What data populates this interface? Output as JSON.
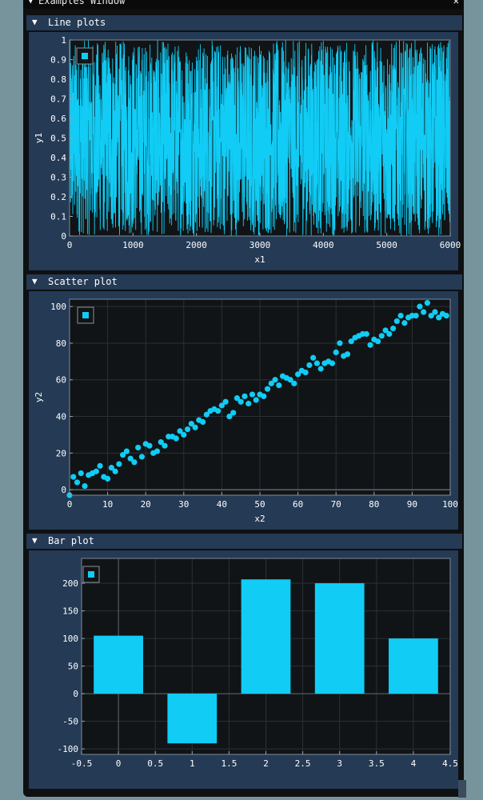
{
  "window": {
    "title": "Examples Window",
    "collapse_glyph": "▼",
    "close_glyph": "✕"
  },
  "sections": [
    {
      "label": "Line plots",
      "glyph": "▼"
    },
    {
      "label": "Scatter plot",
      "glyph": "▼"
    },
    {
      "label": "Bar plot",
      "glyph": "▼"
    }
  ],
  "colors": {
    "series": "#11ccf5",
    "plot_bg": "#111416",
    "frame": "#243a55",
    "header": "#243a55",
    "grid": "#2b3038"
  },
  "chart_data": [
    {
      "type": "line",
      "title": "",
      "xlabel": "x1",
      "ylabel": "y1",
      "xlim": [
        0,
        6000
      ],
      "ylim": [
        0,
        1
      ],
      "xticks": [
        "0",
        "1000",
        "2000",
        "3000",
        "4000",
        "5000",
        "6000"
      ],
      "yticks": [
        "0",
        "0.1",
        "0.2",
        "0.3",
        "0.4",
        "0.5",
        "0.6",
        "0.7",
        "0.8",
        "0.9",
        "1"
      ],
      "series": [
        {
          "points": 6000,
          "min": 0,
          "max": 1,
          "description_values": "dense random noise between 0 and 1"
        }
      ],
      "legend": "top-left"
    },
    {
      "type": "scatter",
      "title": "",
      "xlabel": "x2",
      "ylabel": "y2",
      "xlim": [
        0,
        100
      ],
      "ylim": [
        -3,
        104
      ],
      "xticks": [
        "0",
        "10",
        "20",
        "30",
        "40",
        "50",
        "60",
        "70",
        "80",
        "90",
        "100"
      ],
      "yticks": [
        "0",
        "20",
        "40",
        "60",
        "80",
        "100"
      ],
      "x": [
        0,
        1,
        2,
        3,
        4,
        5,
        6,
        7,
        8,
        9,
        10,
        11,
        12,
        13,
        14,
        15,
        16,
        17,
        18,
        19,
        20,
        21,
        22,
        23,
        24,
        25,
        26,
        27,
        28,
        29,
        30,
        31,
        32,
        33,
        34,
        35,
        36,
        37,
        38,
        39,
        40,
        41,
        42,
        43,
        44,
        45,
        46,
        47,
        48,
        49,
        50,
        51,
        52,
        53,
        54,
        55,
        56,
        57,
        58,
        59,
        60,
        61,
        62,
        63,
        64,
        65,
        66,
        67,
        68,
        69,
        70,
        71,
        72,
        73,
        74,
        75,
        76,
        77,
        78,
        79,
        80,
        81,
        82,
        83,
        84,
        85,
        86,
        87,
        88,
        89,
        90,
        91,
        92,
        93,
        94,
        95,
        96,
        97,
        98,
        99
      ],
      "y": [
        -3,
        7,
        4,
        9,
        2,
        8,
        9,
        10,
        13,
        7,
        6,
        12,
        10,
        14,
        19,
        21,
        17,
        15,
        23,
        18,
        25,
        24,
        20,
        21,
        26,
        24,
        29,
        29,
        28,
        32,
        30,
        33,
        36,
        34,
        38,
        37,
        41,
        43,
        44,
        43,
        46,
        48,
        40,
        42,
        50,
        48,
        51,
        47,
        52,
        49,
        52,
        51,
        55,
        58,
        60,
        57,
        62,
        61,
        60,
        58,
        63,
        65,
        64,
        68,
        72,
        69,
        66,
        69,
        70,
        69,
        75,
        80,
        73,
        74,
        81,
        83,
        84,
        85,
        85,
        79,
        82,
        81,
        84,
        87,
        85,
        88,
        92,
        95,
        91,
        94,
        95,
        95,
        100,
        97,
        102,
        95,
        97,
        94,
        96,
        95
      ],
      "legend": "top-left"
    },
    {
      "type": "bar",
      "title": "",
      "xlabel": "",
      "ylabel": "",
      "xlim": [
        -0.5,
        4.5
      ],
      "ylim": [
        -110,
        245
      ],
      "xticks": [
        "-0.5",
        "0",
        "0.5",
        "1",
        "1.5",
        "2",
        "2.5",
        "3",
        "3.5",
        "4",
        "4.5"
      ],
      "yticks": [
        "-100",
        "-50",
        "0",
        "50",
        "100",
        "150",
        "200"
      ],
      "categories": [
        0,
        1,
        2,
        3,
        4
      ],
      "values": [
        105,
        -90,
        207,
        200,
        100
      ],
      "legend": "top-left"
    }
  ]
}
